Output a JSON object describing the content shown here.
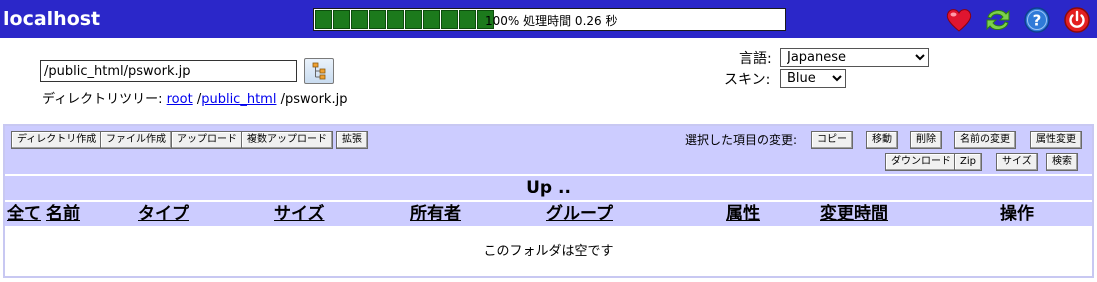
{
  "header": {
    "title": "localhost",
    "progress_percent": 100,
    "progress_text": "100% 処理時間 0.26 秒",
    "icons": [
      "favorite-heart-icon",
      "refresh-icon",
      "help-icon",
      "logout-icon"
    ]
  },
  "path": {
    "value": "/public_html/pswork.jp",
    "tree_label": "ディレクトリツリー:",
    "crumbs": [
      "root",
      "public_html"
    ],
    "current": "pswork.jp"
  },
  "settings": {
    "language_label": "言語:",
    "language_value": "Japanese",
    "skin_label": "スキン:",
    "skin_value": "Blue"
  },
  "toolbar": {
    "left_buttons": [
      "ディレクトリ作成",
      "ファイル作成",
      "アップロード",
      "複数アップロード",
      "拡張"
    ],
    "selection_label": "選択した項目の変更:",
    "right_buttons_row1": [
      "コピー",
      "移動",
      "削除",
      "名前の変更",
      "属性変更"
    ],
    "right_buttons_row2": [
      "ダウンロード",
      "Zip",
      "サイズ",
      "検索"
    ]
  },
  "listing": {
    "up_label": "Up ..",
    "columns": [
      "全て",
      "名前",
      "タイプ",
      "サイズ",
      "所有者",
      "グループ",
      "属性",
      "変更時間",
      "操作"
    ],
    "empty_message": "このフォルダは空です"
  },
  "colors": {
    "header_bg": "#2b27c9",
    "panel_bg": "#ccccff",
    "progress_fill": "#1c7a1c"
  }
}
